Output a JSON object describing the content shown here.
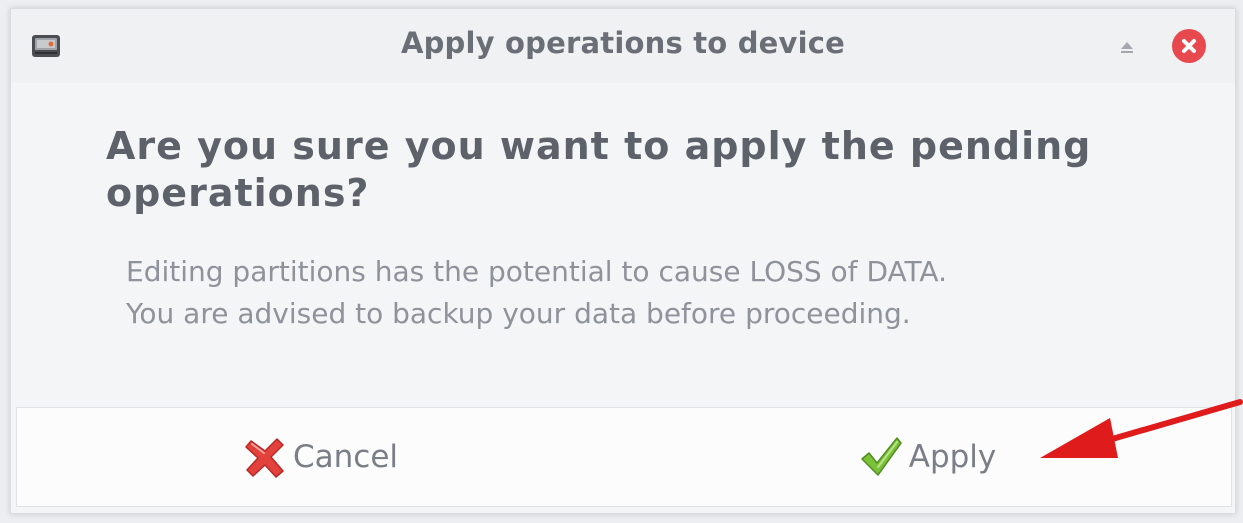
{
  "window": {
    "title": "Apply operations to device"
  },
  "dialog": {
    "heading": "Are you sure you want to apply the pending operations?",
    "message_line1": "Editing partitions has the potential to cause LOSS of DATA.",
    "message_line2": "You are advised to backup your data before proceeding."
  },
  "buttons": {
    "cancel_label": "Cancel",
    "apply_label": "Apply"
  },
  "icons": {
    "app": "gparted-drive-icon",
    "shade": "eject-icon",
    "close": "close-icon",
    "cancel": "red-x-icon",
    "apply": "green-check-icon"
  },
  "colors": {
    "close_button": "#e8494f",
    "cancel_icon": "#e2413c",
    "apply_icon": "#7cc13a",
    "annotation_arrow": "#e01b1b"
  }
}
